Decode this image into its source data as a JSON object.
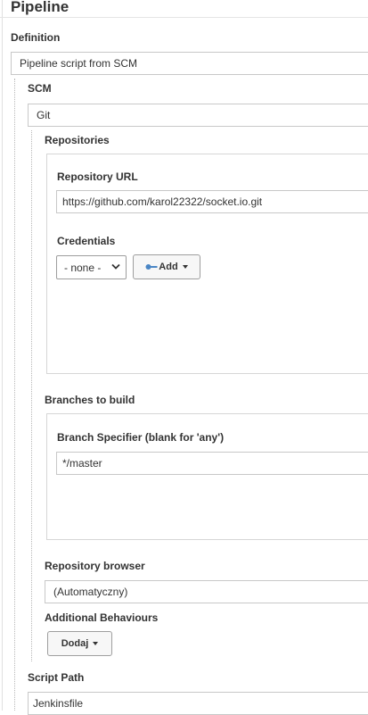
{
  "page": {
    "title": "Pipeline"
  },
  "definition": {
    "label": "Definition",
    "value": "Pipeline script from SCM"
  },
  "scm": {
    "label": "SCM",
    "value": "Git"
  },
  "repositories": {
    "label": "Repositories",
    "url_label": "Repository URL",
    "url_value": "https://github.com/karol22322/socket.io.git",
    "credentials_label": "Credentials",
    "credentials_value": "- none -",
    "add_button": "Add"
  },
  "branches": {
    "label": "Branches to build",
    "specifier_label": "Branch Specifier (blank for 'any')",
    "specifier_value": "*/master"
  },
  "repo_browser": {
    "label": "Repository browser",
    "value": "(Automatyczny)"
  },
  "behaviours": {
    "label": "Additional Behaviours",
    "add_button": "Dodaj"
  },
  "script_path": {
    "label": "Script Path",
    "value": "Jenkinsfile"
  },
  "colors": {
    "key_icon": "#4a86c5"
  },
  "icons": {
    "key": "key-icon",
    "dropdown": "chevron-down-icon"
  }
}
